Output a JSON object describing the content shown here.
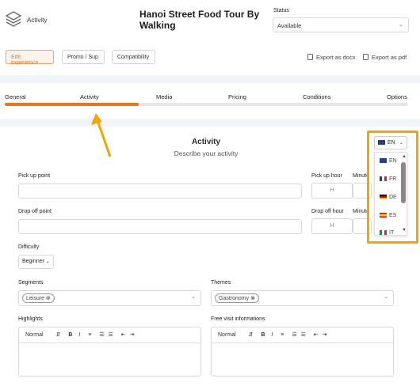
{
  "header": {
    "app_name": "Activity",
    "tour_title": "Hanoi Street Food Tour By Walking",
    "status_label": "Status",
    "status_value": "Available"
  },
  "actions": {
    "edit": "Edit experience",
    "promo": "Promo / Sup",
    "compat": "Compatibility",
    "export_docx": "Export as docx",
    "export_pdf": "Export as pdf"
  },
  "tabs": [
    "General",
    "Activity",
    "Media",
    "Pricing",
    "Conditions",
    "Options"
  ],
  "progress": 0.333,
  "section": {
    "title": "Activity",
    "subtitle": "Describe your activity"
  },
  "form": {
    "pickup_point": "Pick up point",
    "pickup_hour": "Pick up hour",
    "minute": "Minute",
    "hour_ph": "H",
    "dropoff_point": "Drop off point",
    "dropoff_hour": "Drop off hour",
    "difficulty": "Difficulty",
    "difficulty_value": "Beginner",
    "segments": "Segments",
    "segment_chip": "Leisure",
    "themes": "Themes",
    "theme_chip": "Gastronomy",
    "highlights": "Highlights",
    "free_visit": "Free visit informations",
    "format": "Normal"
  },
  "language": {
    "current": "EN",
    "options": [
      "EN",
      "FR",
      "DE",
      "ES",
      "IT"
    ]
  },
  "colors": {
    "accent": "#e87722",
    "highlight": "#f0a800"
  }
}
